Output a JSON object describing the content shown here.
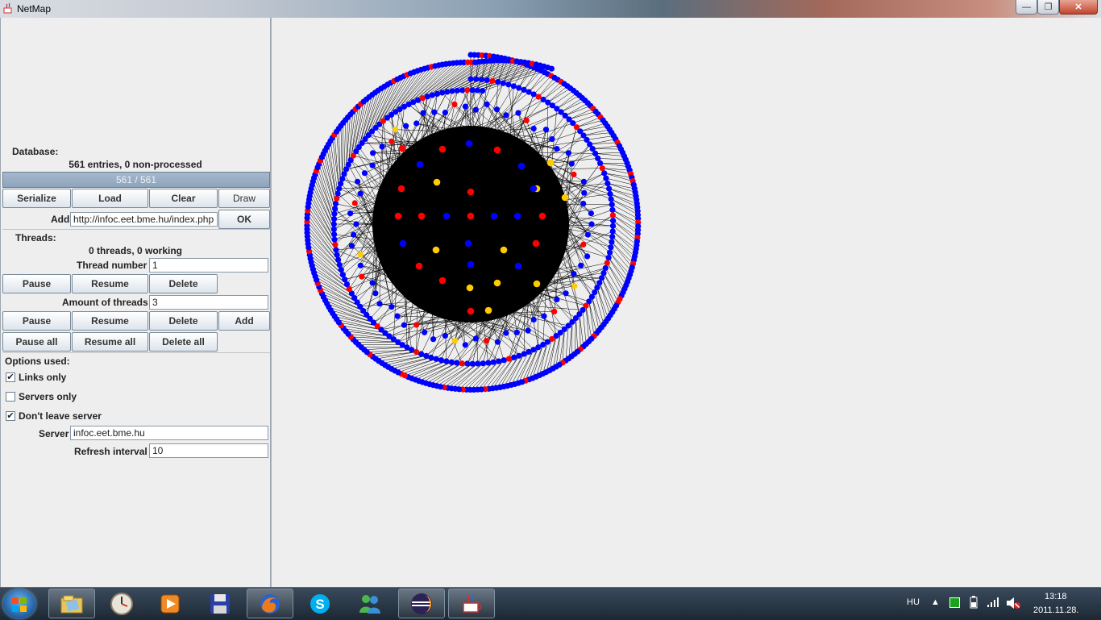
{
  "window": {
    "title": "NetMap",
    "minimize_glyph": "—",
    "maximize_glyph": "❐",
    "close_glyph": "✕"
  },
  "database": {
    "label": "Database:",
    "summary": "561 entries, 0 non-processed",
    "progress_text": "561 / 561",
    "progress_fraction": 1.0,
    "buttons": {
      "serialize": "Serialize",
      "load": "Load",
      "clear": "Clear",
      "draw": "Draw"
    },
    "add_label": "Add",
    "add_value": "http://infoc.eet.bme.hu/index.php",
    "ok_label": "OK"
  },
  "threads": {
    "label": "Threads:",
    "summary": "0 threads, 0 working",
    "thread_number_label": "Thread number",
    "thread_number_value": "1",
    "row1": {
      "pause": "Pause",
      "resume": "Resume",
      "delete": "Delete"
    },
    "amount_label": "Amount of threads",
    "amount_value": "3",
    "row2": {
      "pause": "Pause",
      "resume": "Resume",
      "delete": "Delete",
      "add": "Add"
    },
    "row3": {
      "pause_all": "Pause all",
      "resume_all": "Resume all",
      "delete_all": "Delete all"
    }
  },
  "options": {
    "label": "Options used:",
    "links_only": {
      "label": "Links only",
      "checked": true
    },
    "servers_only": {
      "label": "Servers only",
      "checked": false
    },
    "dont_leave": {
      "label": "Don't leave server",
      "checked": true
    },
    "server_label": "Server",
    "server_value": "infoc.eet.bme.hu",
    "refresh_label": "Refresh interval",
    "refresh_value": "10"
  },
  "graph": {
    "node_colors": {
      "blue": "#0000ff",
      "red": "#ff0000",
      "yellow": "#ffcc00",
      "edge": "#000000"
    }
  },
  "taskbar": {
    "apps": [
      "explorer-icon",
      "clock-app-icon",
      "media-player-icon",
      "save-app-icon",
      "firefox-icon",
      "skype-icon",
      "messenger-icon",
      "eclipse-icon",
      "java-icon"
    ],
    "language": "HU",
    "time": "13:18",
    "date": "2011.11.28."
  }
}
